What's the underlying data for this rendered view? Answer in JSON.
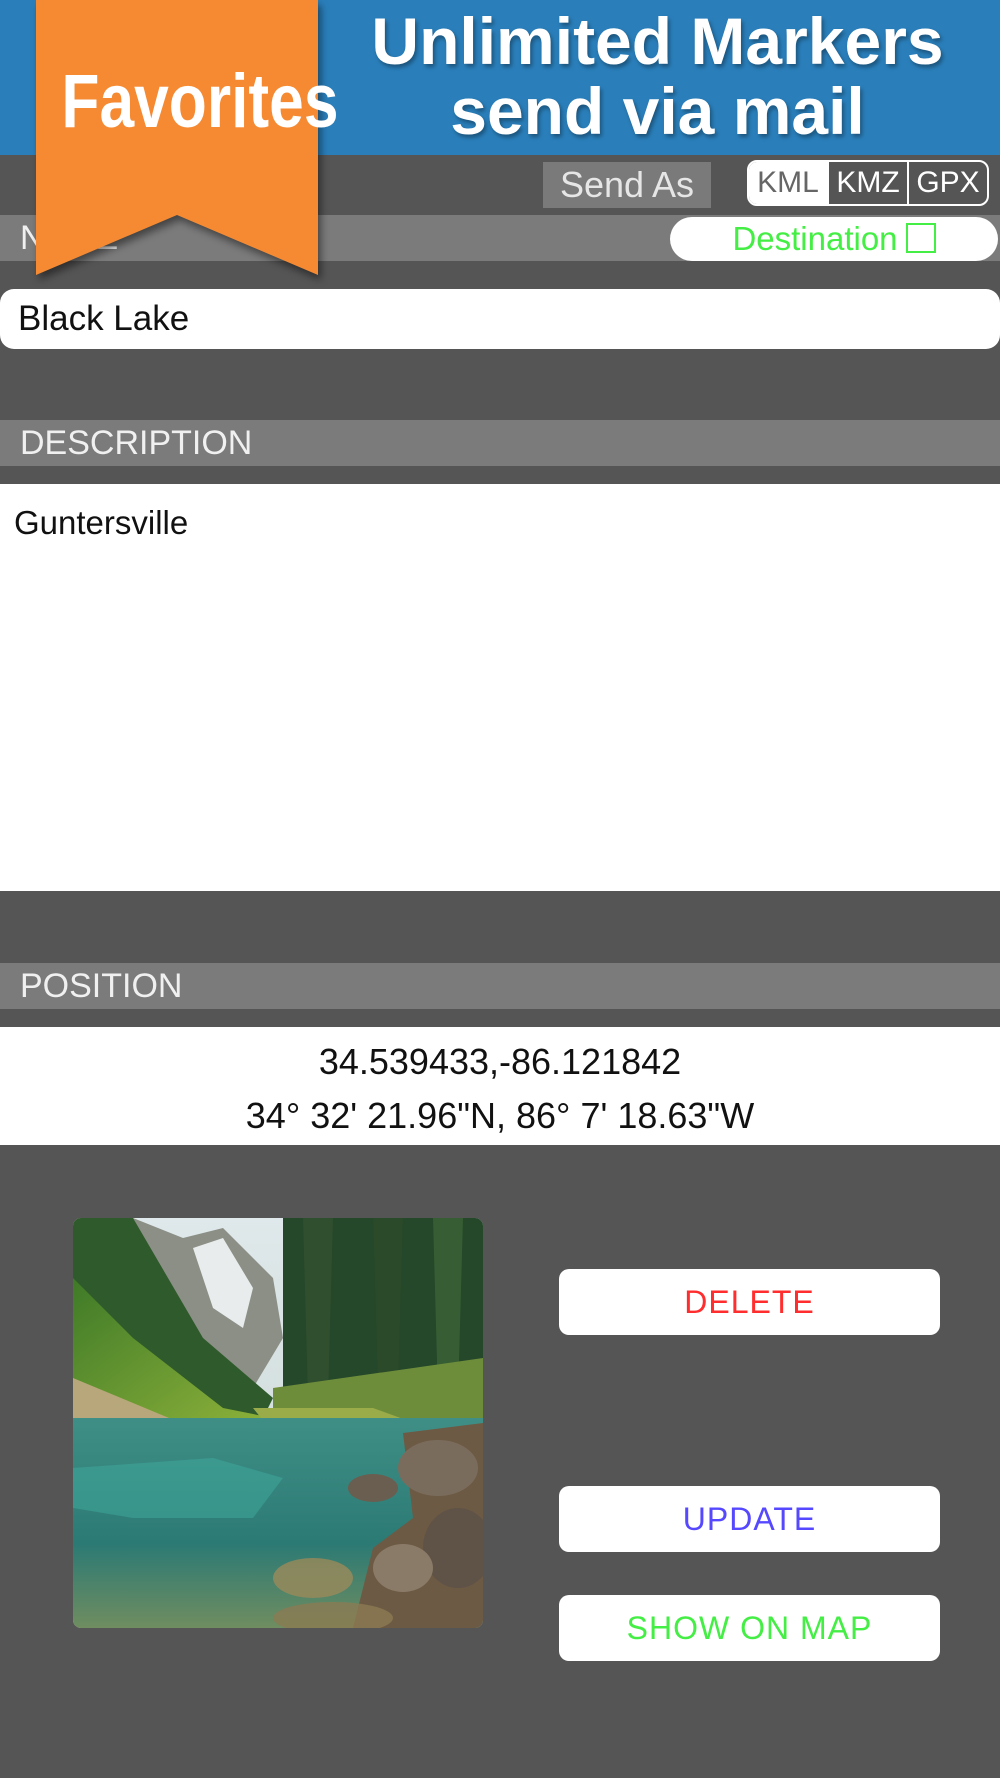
{
  "banner": {
    "ribbon_label": "Favorites",
    "title_line1": "Unlimited Markers",
    "title_line2": "send via mail",
    "colors": {
      "banner": "#2a7fbb",
      "ribbon": "#f58a33"
    }
  },
  "send_as": {
    "label": "Send As",
    "formats": [
      "KML",
      "KMZ",
      "GPX"
    ],
    "selected": "KML"
  },
  "name_section": {
    "header": "NAME",
    "destination_label": "Destination",
    "destination_checked": false,
    "value": "Black Lake"
  },
  "description_section": {
    "header": "DESCRIPTION",
    "value": "Guntersville"
  },
  "position_section": {
    "header": "POSITION",
    "decimal": "34.539433,-86.121842",
    "dms": "34° 32' 21.96\"N, 86° 7' 18.63\"W"
  },
  "photo": {
    "icon": "lake-photo"
  },
  "actions": {
    "delete_label": "DELETE",
    "update_label": "UPDATE",
    "show_on_map_label": "SHOW ON MAP",
    "colors": {
      "delete": "#ff2d2d",
      "update": "#5548ff",
      "show_on_map": "#44ee44"
    }
  }
}
